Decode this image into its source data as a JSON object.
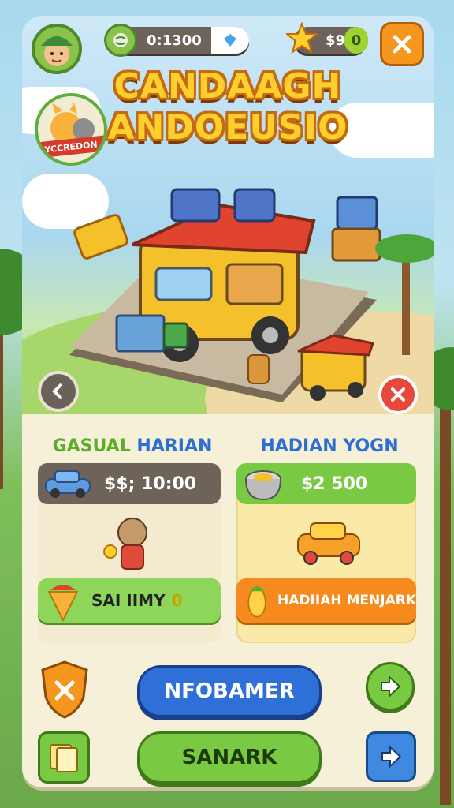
{
  "hud": {
    "progress_value": "0:1300",
    "star_count": "$9",
    "star_badge": "0"
  },
  "title": {
    "line1": "CANDAAGH",
    "line2": "ANDOEUSIO"
  },
  "badge_label": "YCCREDON",
  "columns": {
    "left": {
      "title_part1": "GASUAL",
      "title_part2": "HARIAN",
      "price": "$$; 10:00",
      "action_label": "SAI IIMY",
      "action_count": "0"
    },
    "right": {
      "title": "HADIAN YOGN",
      "price": "$2 500",
      "action_label": "HADIIAH MENJARK"
    }
  },
  "buttons": {
    "primary": "NFOBAMER",
    "secondary": "SANARK"
  },
  "colors": {
    "accent_orange": "#f7961e",
    "accent_green": "#7ac943",
    "accent_blue": "#2f6fd8",
    "title_yellow": "#ffcf2d",
    "close_red": "#e8483a"
  },
  "icons": [
    "avatar-icon",
    "globe-icon",
    "diamond-icon",
    "star-icon",
    "close-icon",
    "back-arrow-icon",
    "car-icon",
    "pot-icon",
    "shield-icon",
    "cards-icon",
    "play-arrow-icon"
  ]
}
